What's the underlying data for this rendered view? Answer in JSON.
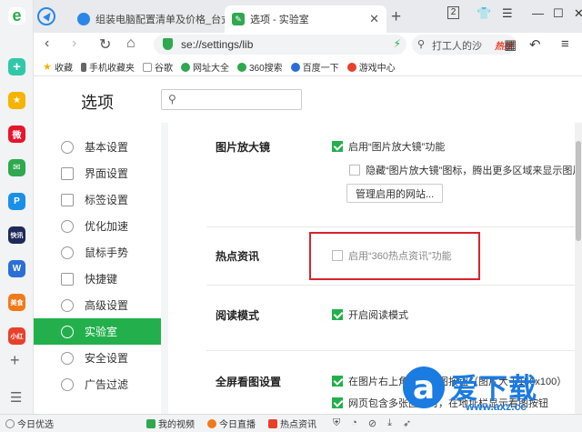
{
  "colors": {
    "accent": "#23b04c",
    "highlight": "#d9232c",
    "brand_blue": "#1a7be0"
  },
  "tabs": [
    {
      "title": "组装电脑配置清单及价格_台式电",
      "icon": "compass-icon"
    },
    {
      "title": "选项 - 实验室",
      "icon": "wrench-icon",
      "active": true
    }
  ],
  "window": {
    "tab_count": "2"
  },
  "address": {
    "url": "se://settings/lib"
  },
  "search": {
    "query": "打工人的沙",
    "hot": "热搜"
  },
  "bookmarks": [
    "收藏",
    "手机收藏夹",
    "谷歌",
    "网址大全",
    "360搜索",
    "百度一下",
    "游戏中心"
  ],
  "settings": {
    "title": "选项",
    "nav": [
      {
        "label": "基本设置",
        "icon": "gear-icon"
      },
      {
        "label": "界面设置",
        "icon": "window-icon"
      },
      {
        "label": "标签设置",
        "icon": "tab-icon"
      },
      {
        "label": "优化加速",
        "icon": "bolt-icon"
      },
      {
        "label": "鼠标手势",
        "icon": "mouse-icon"
      },
      {
        "label": "快捷键",
        "icon": "keyboard-icon"
      },
      {
        "label": "高级设置",
        "icon": "wrench-icon"
      },
      {
        "label": "实验室",
        "icon": "flask-icon",
        "active": true
      },
      {
        "label": "安全设置",
        "icon": "shield-icon"
      },
      {
        "label": "广告过滤",
        "icon": "block-icon"
      }
    ],
    "sections": {
      "magnifier": {
        "title": "图片放大镜",
        "enable": "启用“图片放大镜”功能",
        "hide": "隐藏“图片放大镜”图标，腾出更多区域来显示图片",
        "button": "管理启用的网站..."
      },
      "hotspot": {
        "title": "热点资讯",
        "enable": "启用“360热点资讯”功能"
      },
      "reading": {
        "title": "阅读模式",
        "enable": "开启阅读模式"
      },
      "fullscreen": {
        "title": "全屏看图设置",
        "opt1": "在图片右上角显示看图按钮（图片大于150x100）",
        "opt2": "网页包含多张图片时，在地址栏显示看图按钮"
      }
    }
  },
  "statusbar": [
    "今日优选",
    "我的视频",
    "今日直播",
    "热点资讯"
  ],
  "watermark": {
    "brand": "爱下载",
    "url": "www.axz.cc"
  }
}
